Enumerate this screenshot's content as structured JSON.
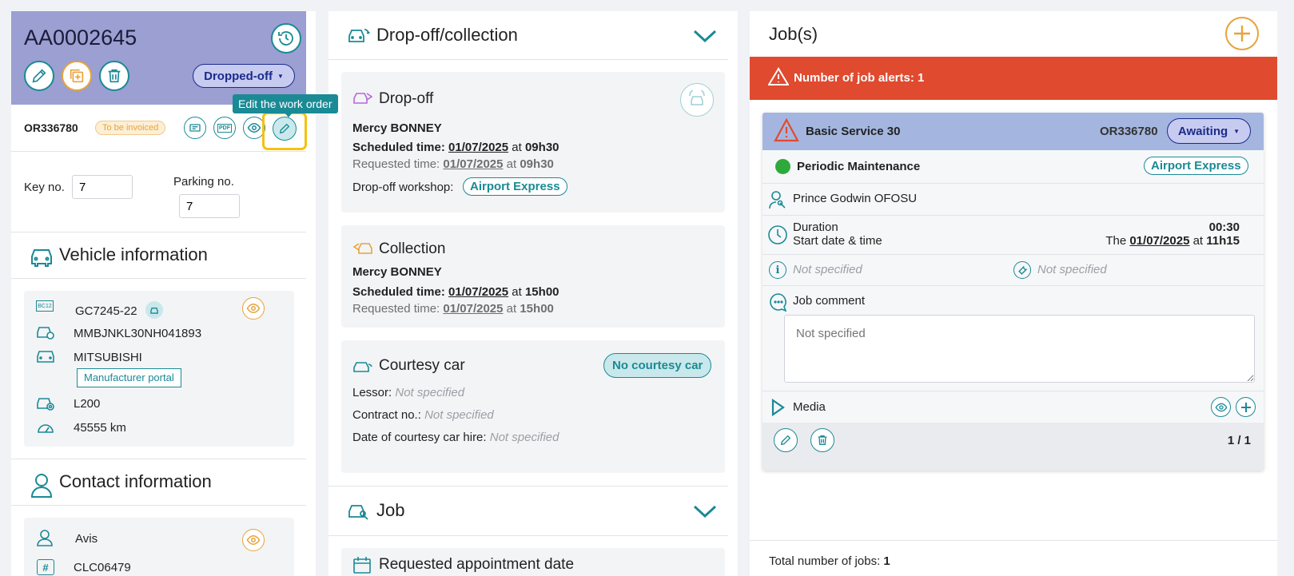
{
  "work_order": {
    "id": "AA0002645",
    "status": "Dropped-off",
    "ref": "OR336780",
    "invoice_badge": "To be invoiced",
    "tooltip": "Edit the work order",
    "key_label": "Key no.",
    "key_value": "7",
    "parking_label": "Parking no.",
    "parking_value": "7"
  },
  "vehicle": {
    "title": "Vehicle information",
    "plate": "GC7245-22",
    "vin": "MMBJNKL30NH041893",
    "make": "MITSUBISHI",
    "portal_button": "Manufacturer portal",
    "model": "L200",
    "mileage": "45555 km",
    "plate_icon_text": "BC12"
  },
  "contact": {
    "title": "Contact information",
    "name": "Avis",
    "code": "CLC06479"
  },
  "dropoff_collection": {
    "title": "Drop-off/collection",
    "dropoff": {
      "title": "Drop-off",
      "person": "Mercy BONNEY",
      "scheduled_label": "Scheduled time:",
      "scheduled_date": "01/07/2025",
      "at": "at",
      "scheduled_time": "09h30",
      "requested_label": "Requested time:",
      "requested_date": "01/07/2025",
      "requested_time": "09h30",
      "workshop_label": "Drop-off workshop:",
      "workshop": "Airport Express"
    },
    "collection": {
      "title": "Collection",
      "person": "Mercy BONNEY",
      "scheduled_label": "Scheduled time:",
      "scheduled_date": "01/07/2025",
      "at": "at",
      "scheduled_time": "15h00",
      "requested_label": "Requested time:",
      "requested_date": "01/07/2025",
      "requested_time": "15h00"
    },
    "courtesy": {
      "title": "Courtesy car",
      "badge": "No courtesy car",
      "lessor_label": "Lessor:",
      "lessor_value": "Not specified",
      "contract_label": "Contract no.:",
      "contract_value": "Not specified",
      "hire_label": "Date of courtesy car hire:",
      "hire_value": "Not specified"
    }
  },
  "job_section": {
    "title": "Job",
    "requested_appointment": "Requested appointment date"
  },
  "jobs": {
    "title": "Job(s)",
    "alert": "Number of job alerts: 1",
    "card": {
      "name": "Basic Service 30",
      "ref": "OR336780",
      "status": "Awaiting",
      "category": "Periodic Maintenance",
      "workshop": "Airport Express",
      "technician": "Prince Godwin OFOSU",
      "duration_label": "Duration",
      "duration_value": "00:30",
      "start_label": "Start date & time",
      "start_prefix": "The",
      "start_date": "01/07/2025",
      "start_at": "at",
      "start_time": "11h15",
      "info_value": "Not specified",
      "tool_value": "Not specified",
      "comment_label": "Job comment",
      "comment_placeholder": "Not specified",
      "media_label": "Media",
      "pagination": "1 / 1"
    },
    "total_label": "Total number of jobs:",
    "total_value": "1"
  },
  "colors": {
    "teal": "#1a8a95",
    "orange": "#e8a33a",
    "header_purple": "#9b9fd1",
    "alert_red": "#e04a2f",
    "job_header_blue": "#a4b6e0",
    "status_navy": "#1b2b8c",
    "green_dot": "#2eaa3d"
  }
}
